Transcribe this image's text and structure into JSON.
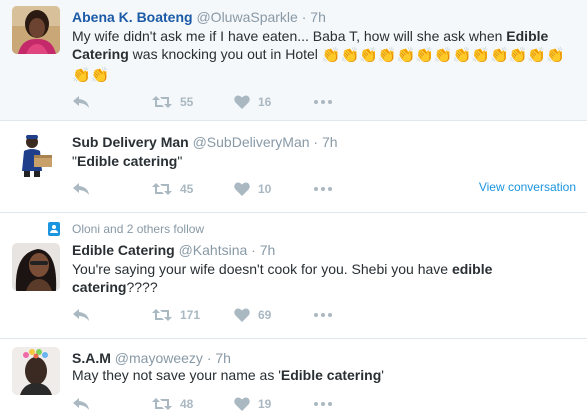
{
  "colors": {
    "highlight_bg": "#f5f8fa",
    "name_blue": "#1b5aa6",
    "link_blue": "#1b95e0",
    "muted": "#8899a6",
    "action_icon": "#aab8c2",
    "text": "#292f33"
  },
  "tweets": [
    {
      "name": "Abena K. Boateng",
      "handle": "@OluwaSparkle",
      "separator": "·",
      "time": "7h",
      "text_1": "My wife didn't ask me if I have eaten... Baba T, how will she ask when ",
      "bold_1": "Edible Catering",
      "text_2": " was knocking you out in Hotel",
      "emoji": "👏",
      "emoji_icon": "clapping-hands-icon",
      "retweets": "55",
      "likes": "16"
    },
    {
      "name": "Sub Delivery Man",
      "handle": "@SubDeliveryMan",
      "separator": "·",
      "time": "7h",
      "text_1": "\"",
      "bold_1": "Edible catering",
      "text_2": "\"",
      "retweets": "45",
      "likes": "10",
      "view_conversation": "View conversation"
    },
    {
      "social_context": "Oloni and 2 others follow",
      "name": "Edible Catering",
      "handle": "@Kahtsina",
      "separator": "·",
      "time": "7h",
      "text_1": "You're saying your wife doesn't cook for you. Shebi you have ",
      "bold_1": "edible catering",
      "text_2": "????",
      "retweets": "171",
      "likes": "69"
    },
    {
      "name": "S.A.M",
      "handle": "@mayoweezy",
      "separator": "·",
      "time": "7h",
      "text_1": "May they not save your name as '",
      "bold_1": "Edible catering",
      "text_2": "'",
      "retweets": "48",
      "likes": "19"
    }
  ]
}
